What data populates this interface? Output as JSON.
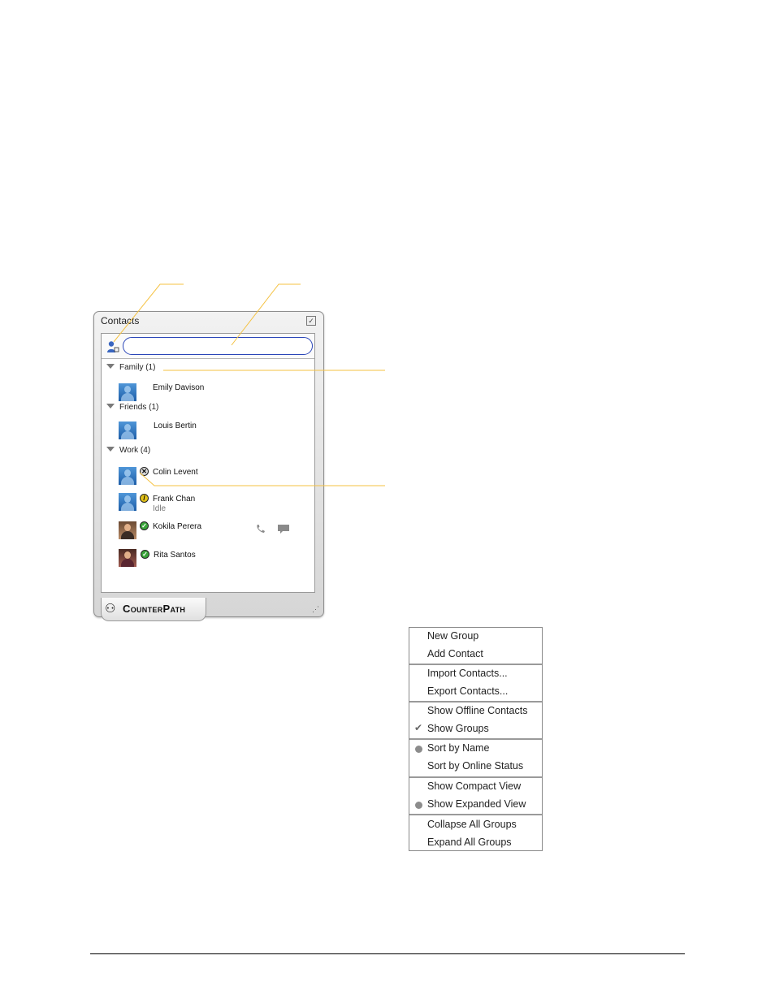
{
  "window": {
    "title": "Contacts",
    "search": {
      "value": "",
      "placeholder": ""
    },
    "groups": [
      {
        "label": "Family (1)",
        "contacts": [
          {
            "name": "Emily Davison",
            "status": "none"
          }
        ]
      },
      {
        "label": "Friends (1)",
        "contacts": [
          {
            "name": "Louis Bertin",
            "status": "none"
          }
        ]
      },
      {
        "label": "Work (4)",
        "contacts": [
          {
            "name": "Colin Levent",
            "status": "offline"
          },
          {
            "name": "Frank Chan",
            "status": "idle",
            "substatus": "Idle"
          },
          {
            "name": "Kokila Perera",
            "status": "online"
          },
          {
            "name": "Rita Santos",
            "status": "online"
          }
        ]
      }
    ],
    "logo_text": "CounterPath",
    "icons": {
      "add_contact": "add-contact-icon",
      "options": "options-icon",
      "call": "phone-icon",
      "im": "chat-bubble-icon",
      "resize": "resize-grip-icon"
    }
  },
  "context_menu": {
    "sections": [
      [
        "New Group",
        "Add Contact"
      ],
      [
        "Import Contacts...",
        "Export Contacts..."
      ],
      [
        "Show Offline Contacts",
        "Show Groups"
      ],
      [
        "Sort by Name",
        "Sort by Online Status"
      ],
      [
        "Show Compact View",
        "Show Expanded View"
      ],
      [
        "Collapse All Groups",
        "Expand All Groups"
      ]
    ],
    "checked": "Show Groups",
    "selected_sort": "Sort by Name",
    "selected_view": "Show Expanded View"
  },
  "colors": {
    "callout": "#f5c242",
    "search_border": "#2b46b8"
  }
}
